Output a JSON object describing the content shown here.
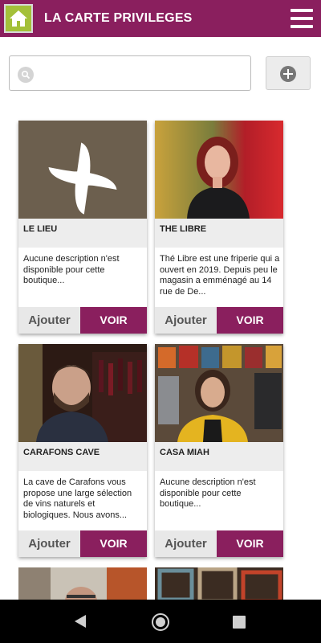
{
  "app": {
    "title": "LA CARTE PRIVILEGES"
  },
  "search": {
    "value": "",
    "placeholder": ""
  },
  "colors": {
    "brand": "#8a1f5e",
    "home_button": "#a4c03a"
  },
  "cards": [
    {
      "name": "LE LIEU",
      "description": "Aucune description n'est disponible pour cette boutique...",
      "add_label": "Ajouter",
      "view_label": "VOIR"
    },
    {
      "name": "THE LIBRE",
      "description": "Thé Libre est une friperie qui a ouvert en 2019. Depuis peu le magasin a emménagé au 14 rue de De...",
      "add_label": "Ajouter",
      "view_label": "VOIR"
    },
    {
      "name": "CARAFONS CAVE",
      "description": "La cave de Carafons vous propose une large sélection de vins naturels et biologiques. Nous avons...",
      "add_label": "Ajouter",
      "view_label": "VOIR"
    },
    {
      "name": "CASA MIAH",
      "description": "Aucune description n'est disponible pour cette boutique...",
      "add_label": "Ajouter",
      "view_label": "VOIR"
    }
  ],
  "icons": {
    "home": "home-icon",
    "menu": "hamburger-menu-icon",
    "search": "search-icon",
    "add": "plus-circle-icon",
    "nav_back": "back-triangle-icon",
    "nav_home": "home-circle-icon",
    "nav_recent": "recent-square-icon"
  }
}
